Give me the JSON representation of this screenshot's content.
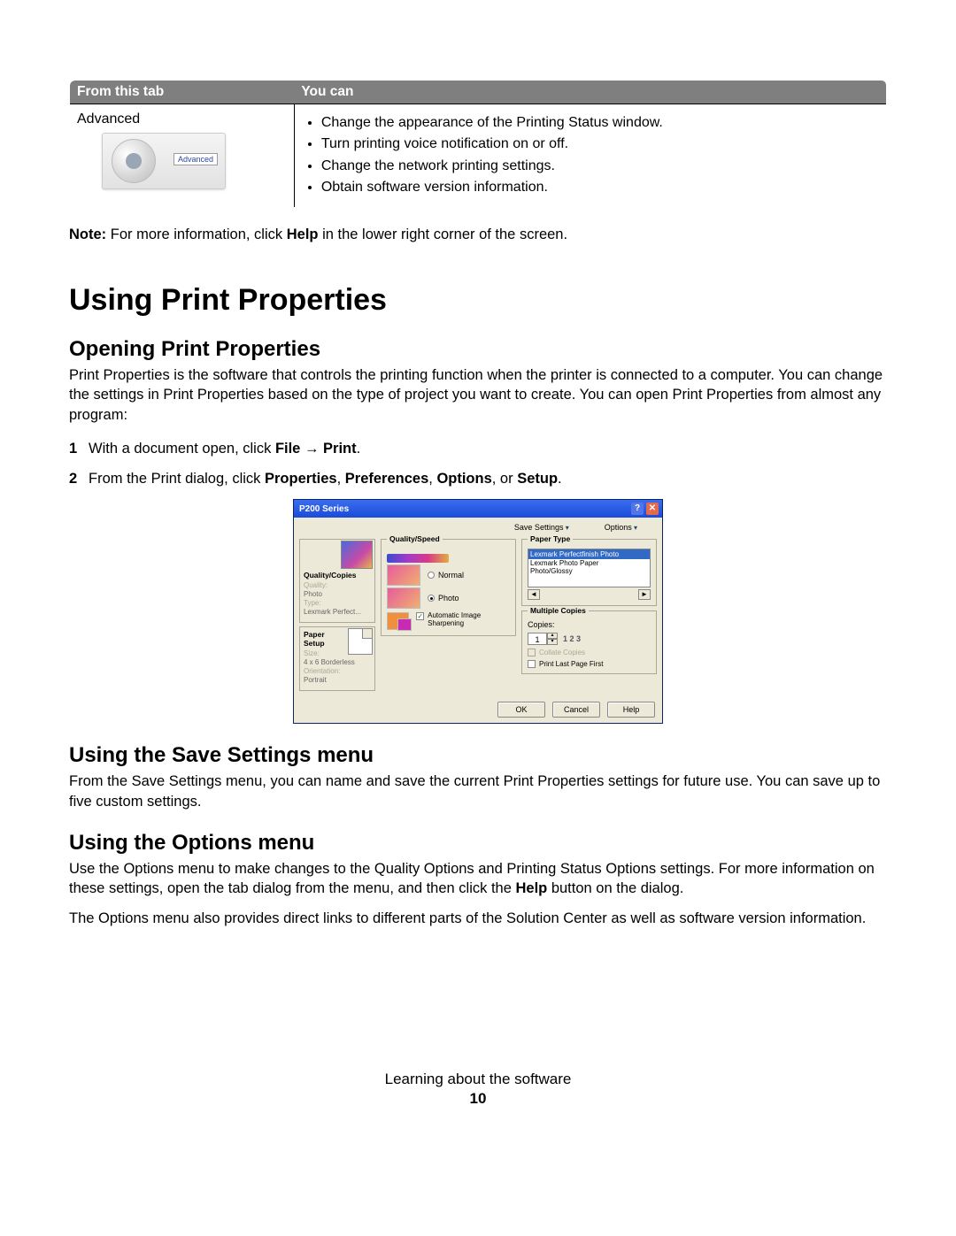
{
  "table": {
    "headers": [
      "From this tab",
      "You can"
    ],
    "row": {
      "tab_name": "Advanced",
      "thumb_label": "Advanced",
      "bullets": [
        "Change the appearance of the Printing Status window.",
        "Turn printing voice notification on or off.",
        "Change the network printing settings.",
        "Obtain software version information."
      ]
    }
  },
  "note": {
    "prefix": "Note:",
    "text_before": " For more information, click ",
    "bold": "Help",
    "text_after": " in the lower right corner of the screen."
  },
  "h1": "Using Print Properties",
  "s1": {
    "title": "Opening Print Properties",
    "para": "Print Properties is the software that controls the printing function when the printer is connected to a computer. You can change the settings in Print Properties based on the type of project you want to create. You can open Print Properties from almost any program:",
    "steps": [
      {
        "n": "1",
        "pre": "With a document open, click ",
        "b1": "File",
        "arrow": " → ",
        "b2": "Print",
        "post": "."
      },
      {
        "n": "2",
        "pre": "From the Print dialog, click ",
        "b1": "Properties",
        "c1": ", ",
        "b2": "Preferences",
        "c2": ", ",
        "b3": "Options",
        "c3": ", or ",
        "b4": "Setup",
        "post": "."
      }
    ]
  },
  "dialog": {
    "title": "P200 Series",
    "toolbar": {
      "save": "Save Settings",
      "options": "Options"
    },
    "side": {
      "qc": {
        "title": "Quality/Copies",
        "l1": "Quality:",
        "l1v": "Photo",
        "l2": "Type:",
        "l2v": "Lexmark Perfect..."
      },
      "ps": {
        "title": "Paper Setup",
        "l1": "Size:",
        "l1v": "4 x 6 Borderless",
        "l2": "Orientation:",
        "l2v": "Portrait"
      }
    },
    "qs": {
      "title": "Quality/Speed",
      "normal": "Normal",
      "photo": "Photo",
      "chk": "Automatic Image Sharpening"
    },
    "pt": {
      "title": "Paper Type",
      "sel": "Lexmark Perfectfinish Photo",
      "o1": "Lexmark Photo Paper",
      "o2": "Photo/Glossy"
    },
    "mc": {
      "title": "Multiple Copies",
      "copies": "Copies:",
      "val": "1",
      "stack": "1 2 3",
      "collate": "Collate Copies",
      "last": "Print Last Page First"
    },
    "buttons": {
      "ok": "OK",
      "cancel": "Cancel",
      "help": "Help"
    }
  },
  "s2": {
    "title": "Using the Save Settings menu",
    "para": "From the Save Settings menu, you can name and save the current Print Properties settings for future use. You can save up to five custom settings."
  },
  "s3": {
    "title": "Using the Options menu",
    "p1_a": "Use the Options menu to make changes to the Quality Options and Printing Status Options settings. For more information on these settings, open the tab dialog from the menu, and then click the ",
    "p1_b": "Help",
    "p1_c": " button on the dialog.",
    "p2": "The Options menu also provides direct links to different parts of the Solution Center as well as software version information."
  },
  "footer": {
    "section": "Learning about the software",
    "page": "10"
  }
}
